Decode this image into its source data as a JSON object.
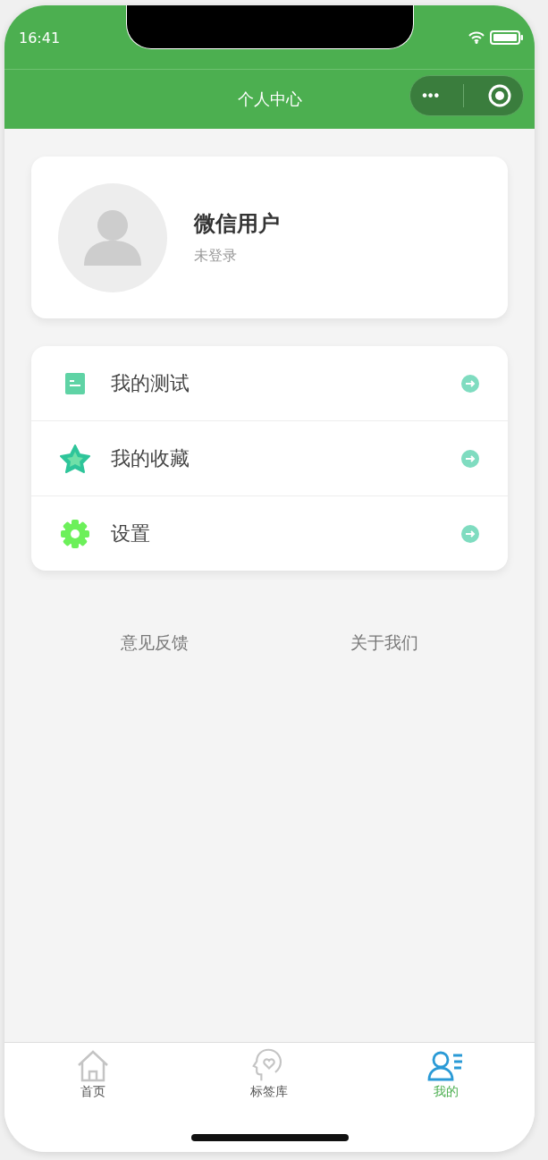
{
  "status_bar": {
    "time": "16:41"
  },
  "nav_bar": {
    "title": "个人中心",
    "capsule": {
      "more": "•••"
    }
  },
  "profile": {
    "name": "微信用户",
    "status": "未登录"
  },
  "menu": [
    {
      "kind": "test",
      "label": "我的测试"
    },
    {
      "kind": "favorite",
      "label": "我的收藏"
    },
    {
      "kind": "settings",
      "label": "设置"
    }
  ],
  "links": [
    "意见反馈",
    "关于我们"
  ],
  "tab_bar": [
    {
      "kind": "home",
      "label": "首页",
      "selected": false
    },
    {
      "kind": "tags",
      "label": "标签库",
      "selected": false
    },
    {
      "kind": "me",
      "label": "我的",
      "selected": true
    }
  ]
}
